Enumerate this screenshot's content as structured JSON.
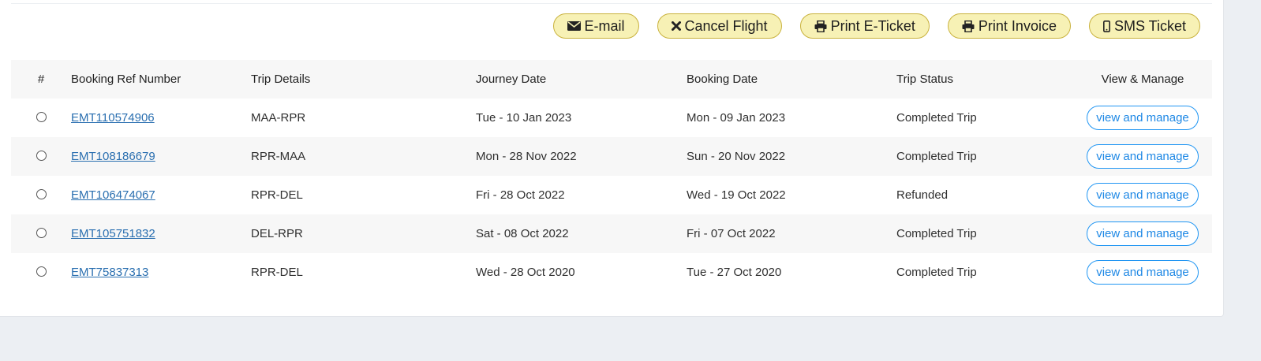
{
  "toolbar": {
    "buttons": [
      {
        "label": "E-mail",
        "icon": "envelope-icon"
      },
      {
        "label": "Cancel Flight",
        "icon": "close-icon"
      },
      {
        "label": "Print E-Ticket",
        "icon": "printer-icon"
      },
      {
        "label": "Print Invoice",
        "icon": "printer-icon"
      },
      {
        "label": "SMS Ticket",
        "icon": "mobile-phone-icon"
      }
    ]
  },
  "table": {
    "headers": {
      "num": "#",
      "ref": "Booking Ref Number",
      "trip": "Trip Details",
      "journey": "Journey Date",
      "booking": "Booking Date",
      "status": "Trip Status",
      "view": "View & Manage"
    },
    "rows": [
      {
        "ref": "EMT110574906",
        "trip": "MAA-RPR",
        "journey": "Tue - 10 Jan 2023",
        "booking": "Mon - 09 Jan 2023",
        "status": "Completed Trip",
        "action": "view and manage"
      },
      {
        "ref": "EMT108186679",
        "trip": "RPR-MAA",
        "journey": "Mon - 28 Nov 2022",
        "booking": "Sun - 20 Nov 2022",
        "status": "Completed Trip",
        "action": "view and manage"
      },
      {
        "ref": "EMT106474067",
        "trip": "RPR-DEL",
        "journey": "Fri - 28 Oct 2022",
        "booking": "Wed - 19 Oct 2022",
        "status": "Refunded",
        "action": "view and manage"
      },
      {
        "ref": "EMT105751832",
        "trip": "DEL-RPR",
        "journey": "Sat - 08 Oct 2022",
        "booking": "Fri - 07 Oct 2022",
        "status": "Completed Trip",
        "action": "view and manage"
      },
      {
        "ref": "EMT75837313",
        "trip": "RPR-DEL",
        "journey": "Wed - 28 Oct 2020",
        "booking": "Tue - 27 Oct 2020",
        "status": "Completed Trip",
        "action": "view and manage"
      }
    ]
  },
  "colors": {
    "toolbar_button_bg": "#f7f1b5",
    "toolbar_button_border": "#c9b23d",
    "link": "#2a6fb0",
    "manage_button": "#1e88e5",
    "page_bg": "#eceff3"
  }
}
